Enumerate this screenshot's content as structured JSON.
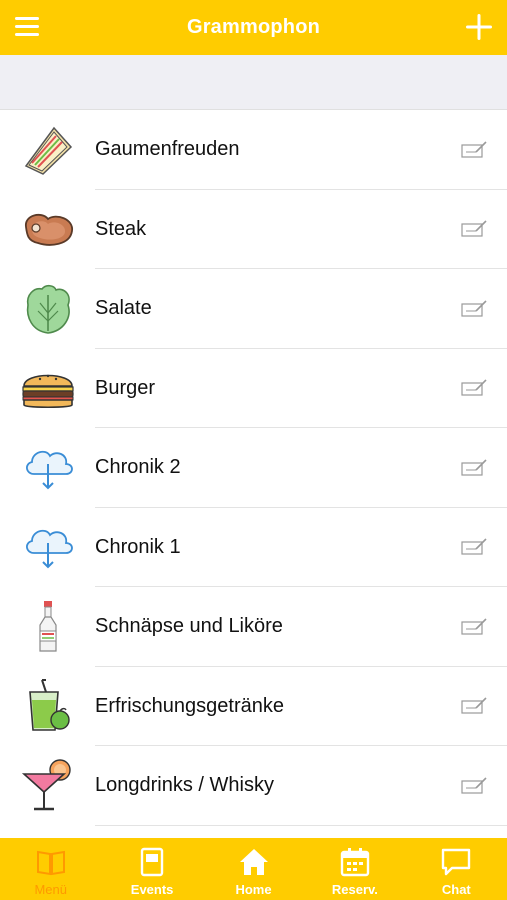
{
  "header": {
    "title": "Grammophon",
    "menu_icon": "hamburger-icon",
    "add_icon": "plus-icon"
  },
  "colors": {
    "accent": "#FFCC00",
    "active_tab": "#FF9900",
    "subbar": "#EFEFF4"
  },
  "menu": {
    "items": [
      {
        "label": "Gaumenfreuden",
        "icon": "sandwich-icon"
      },
      {
        "label": "Steak",
        "icon": "steak-icon"
      },
      {
        "label": "Salate",
        "icon": "lettuce-icon"
      },
      {
        "label": "Burger",
        "icon": "burger-icon"
      },
      {
        "label": "Chronik 2",
        "icon": "cloud-download-icon"
      },
      {
        "label": "Chronik 1",
        "icon": "cloud-download-icon"
      },
      {
        "label": "Schnäpse und Liköre",
        "icon": "liquor-bottle-icon"
      },
      {
        "label": "Erfrischungsgetränke",
        "icon": "juice-glass-icon"
      },
      {
        "label": "Longdrinks / Whisky",
        "icon": "cocktail-icon"
      }
    ]
  },
  "tabs": [
    {
      "label": "Menü",
      "icon": "book-icon",
      "active": true
    },
    {
      "label": "Events",
      "icon": "document-icon",
      "active": false
    },
    {
      "label": "Home",
      "icon": "house-icon",
      "active": false
    },
    {
      "label": "Reserv.",
      "icon": "calendar-icon",
      "active": false
    },
    {
      "label": "Chat",
      "icon": "chat-bubble-icon",
      "active": false
    }
  ]
}
